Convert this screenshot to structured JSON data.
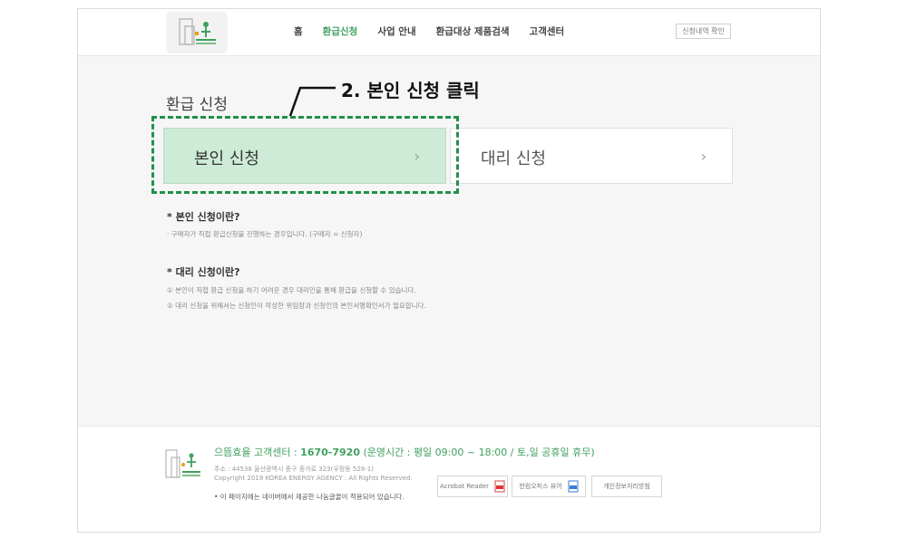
{
  "header": {
    "nav": [
      "홈",
      "환급신청",
      "사업 안내",
      "환급대상 제품검색",
      "고객센터"
    ],
    "active_nav": "환급신청",
    "history_button": "신청내역 확인"
  },
  "main": {
    "title": "환급 신청",
    "self_card": "본인 신청",
    "proxy_card": "대리 신청",
    "chevron": "›",
    "info_self_title": "본인 신청이란?",
    "info_self_desc": "· 구매자가 직접 환급신청을 진행하는 경우입니다. (구매자 = 신청자)",
    "info_proxy_title": "대리 신청이란?",
    "info_proxy_desc1": "① 본인이 직접 환급 신청을 하기 어려운 경우 대리인을 통해 환급을 신청할 수 있습니다.",
    "info_proxy_desc2": "② 대리 신청을 위해서는 신청인이 작성한 위임장과 신청인의 본인서명확인서가 필요합니다."
  },
  "footer": {
    "center_label": "으뜸효율 고객센터 :",
    "center_phone": "1670-7920",
    "center_hours": "(운영시간 : 평일 09:00 ~ 18:00 / 토,일 공휴일 휴무)",
    "address": "주소 : 44538 울산광역시 중구 종가로 323(우정동 528-1)",
    "copyright": "Copyright 2019 KOREA ENERGY AGENCY . All Rights Reserved.",
    "font_note": "• 이 페이지에는 네이버에서 제공한 나눔글꼴이 적용되어 있습니다.",
    "btn_acrobat": "Acrobat Reader",
    "btn_hwp": "한컴오피스 뷰어",
    "btn_privacy": "개인정보처리방침"
  },
  "annotation": {
    "callout": "2. 본인 신청 클릭"
  },
  "colors": {
    "accent_green": "#3fa05f",
    "card_selected_bg": "#cdebd6",
    "highlight_border": "#1f9148"
  }
}
